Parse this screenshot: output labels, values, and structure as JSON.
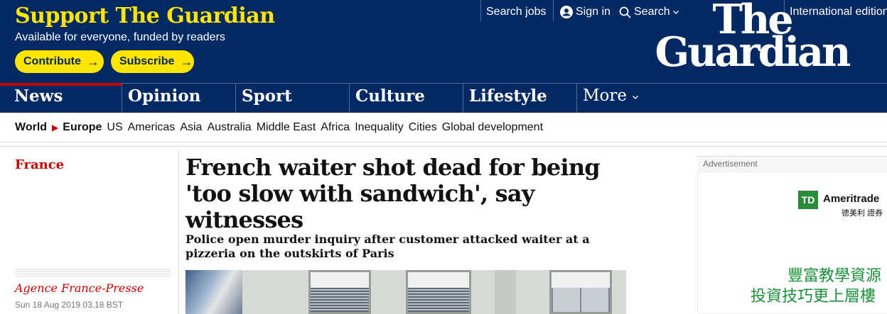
{
  "support": {
    "title": "Support The Guardian",
    "subtitle": "Available for everyone, funded by readers",
    "contribute_label": "Contribute",
    "subscribe_label": "Subscribe"
  },
  "top_links": {
    "search_jobs": "Search jobs",
    "sign_in": "Sign in",
    "search": "Search",
    "edition": "International edition"
  },
  "logo": {
    "line1": "The",
    "line2": "Guardian"
  },
  "pillars": [
    {
      "label": "News",
      "active": true
    },
    {
      "label": "Opinion"
    },
    {
      "label": "Sport"
    },
    {
      "label": "Culture"
    },
    {
      "label": "Lifestyle"
    },
    {
      "label": "More"
    }
  ],
  "subnav": [
    "World",
    "Europe",
    "US",
    "Americas",
    "Asia",
    "Australia",
    "Middle East",
    "Africa",
    "Inequality",
    "Cities",
    "Global development"
  ],
  "article": {
    "section": "France",
    "headline": "French waiter shot dead for being 'too slow with sandwich', say witnesses",
    "standfirst": "Police open murder inquiry after customer attacked waiter at a pizzeria on the outskirts of Paris",
    "byline": "Agence France-Presse",
    "date": "Sun 18 Aug 2019 03.18 BST"
  },
  "ad": {
    "label": "Advertisement",
    "brand": "Ameritrade",
    "brand_mark": "TD",
    "brand_sub": "德美利 證券",
    "line1": "豐富教學資源",
    "line2": "投資技巧更上層樓"
  },
  "colors": {
    "brand_blue": "#052962",
    "support_yellow": "#ffe500",
    "news_red": "#c70000"
  },
  "icons": [
    "user-icon",
    "search-icon",
    "chevron-down-icon",
    "arrow-right-icon"
  ]
}
